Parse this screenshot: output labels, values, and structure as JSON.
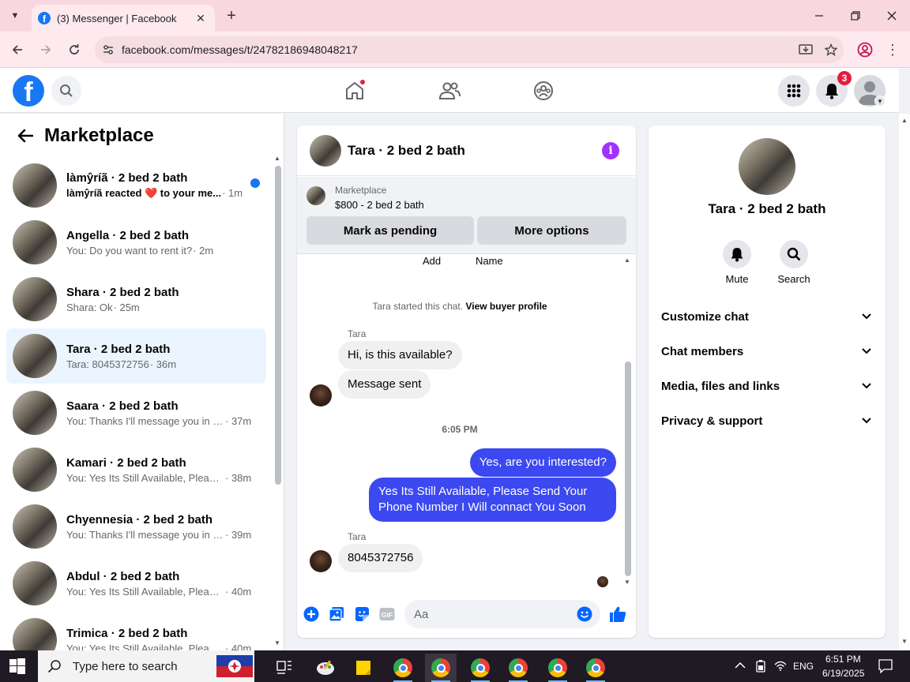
{
  "browser": {
    "tab_title": "(3) Messenger | Facebook",
    "url": "facebook.com/messages/t/24782186948048217"
  },
  "fb_header": {
    "notification_count": "3"
  },
  "left_panel": {
    "title": "Marketplace",
    "conversations": [
      {
        "name": "làmŷríã · 2 bed 2 bath",
        "preview": "làmŷríã reacted ❤️ to your me...",
        "time": "· 1m",
        "unread": true,
        "active": false
      },
      {
        "name": "Angella · 2 bed 2 bath",
        "preview": "You: Do you want to rent it?",
        "time": "· 2m",
        "unread": false,
        "active": false
      },
      {
        "name": "Shara · 2 bed 2 bath",
        "preview": "Shara: Ok",
        "time": "· 25m",
        "unread": false,
        "active": false
      },
      {
        "name": "Tara · 2 bed 2 bath",
        "preview": "Tara: 8045372756",
        "time": "· 36m",
        "unread": false,
        "active": true
      },
      {
        "name": "Saara · 2 bed 2 bath",
        "preview": "You: Thanks I'll message you in a ...",
        "time": "· 37m",
        "unread": false,
        "active": false
      },
      {
        "name": "Kamari · 2 bed 2 bath",
        "preview": "You: Yes Its Still Available, Please ...",
        "time": "· 38m",
        "unread": false,
        "active": false
      },
      {
        "name": "Chyennesia · 2 bed 2 bath",
        "preview": "You: Thanks I'll message you in a ...",
        "time": "· 39m",
        "unread": false,
        "active": false
      },
      {
        "name": "Abdul · 2 bed 2 bath",
        "preview": "You: Yes Its Still Available, Please ...",
        "time": "· 40m",
        "unread": false,
        "active": false
      },
      {
        "name": "Trimica · 2 bed 2 bath",
        "preview": "You: Yes Its Still Available, Please ...",
        "time": "· 40m",
        "unread": false,
        "active": false
      }
    ]
  },
  "chat": {
    "title": "Tara · 2 bed 2 bath",
    "marketplace_label": "Marketplace",
    "listing": "$800 - 2 bed 2 bath",
    "mark_pending_label": "Mark as pending",
    "more_options_label": "More options",
    "cut_left": "Add",
    "cut_right": "Name",
    "system_text": "Tara started this chat.",
    "view_buyer_profile": "View buyer profile",
    "sender_name": "Tara",
    "messages_in_1": [
      "Hi, is this available?",
      "Message sent"
    ],
    "time_separator": "6:05 PM",
    "messages_out": [
      "Yes, are you interested?",
      "Yes Its Still Available, Please Send Your Phone Number I Will connact You Soon"
    ],
    "message_in_2": "8045372756",
    "composer_placeholder": "Aa"
  },
  "right_panel": {
    "title": "Tara · 2 bed 2 bath",
    "mute_label": "Mute",
    "search_label": "Search",
    "sections": [
      "Customize chat",
      "Chat members",
      "Media, files and links",
      "Privacy & support"
    ]
  },
  "taskbar": {
    "search_placeholder": "Type here to search",
    "language": "ENG",
    "time": "6:51 PM",
    "date": "6/19/2025"
  },
  "colors": {
    "facebook_blue": "#1877f2",
    "outgoing_bubble": "#3c49f0",
    "incoming_bubble": "#f0f0f0",
    "info_purple": "#a033ff",
    "badge_red": "#e41e3f"
  }
}
